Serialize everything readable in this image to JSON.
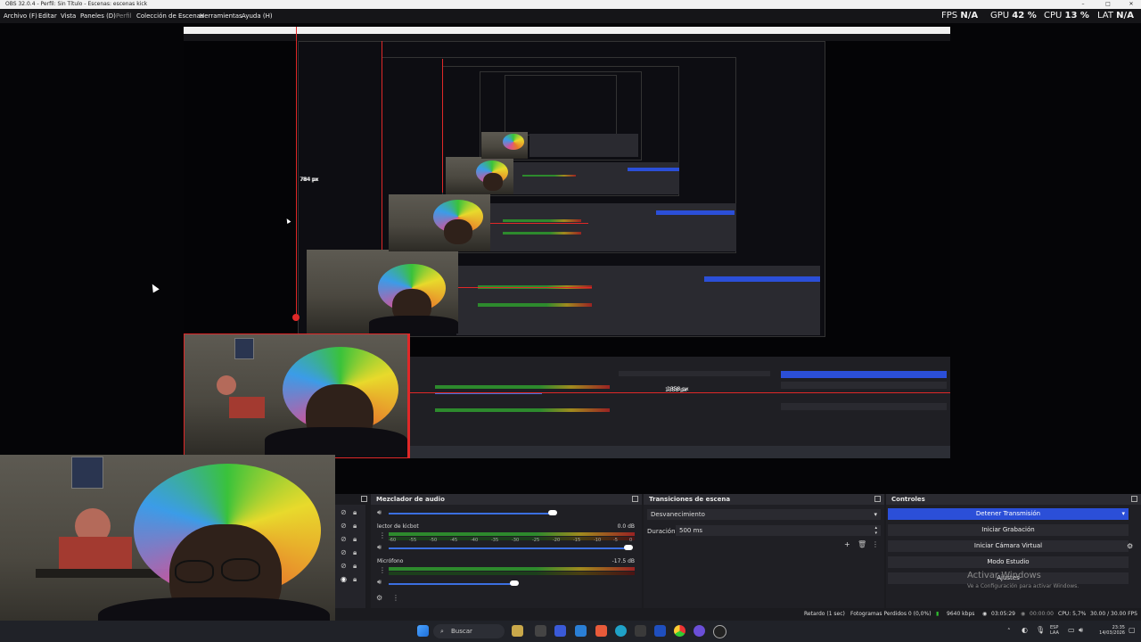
{
  "window": {
    "title": "OBS 32.0.4 - Perfil: Sin Título - Escenas: escenas kick"
  },
  "menu": {
    "items": [
      "Archivo (F)",
      "Editar",
      "Vista",
      "Paneles (D)",
      "Perfil",
      "Colección de Escenas",
      "Herramientas",
      "Ayuda (H)"
    ]
  },
  "stats": {
    "fps_label": "FPS",
    "fps_value": "N/A",
    "gpu_label": "GPU",
    "gpu_value": "42 %",
    "cpu_label": "CPU",
    "cpu_value": "13 %",
    "lat_label": "LAT",
    "lat_value": "N/A"
  },
  "preview": {
    "px_label_1": "784 px",
    "px_label_2": "1358 px",
    "px_label_3": "784 px"
  },
  "mixer": {
    "title": "Mezclador de audio",
    "tracks": [
      {
        "name": "",
        "db": ""
      },
      {
        "name": "lector de kicbot",
        "db": "0.0 dB"
      },
      {
        "name": "Micrófono",
        "db": "-17.5 dB"
      }
    ],
    "ticks": [
      "-60",
      "-55",
      "-50",
      "-45",
      "-40",
      "-35",
      "-30",
      "-25",
      "-20",
      "-15",
      "-10",
      "-5",
      "0"
    ]
  },
  "transitions": {
    "title": "Transiciones de escena",
    "selected": "Desvanecimiento",
    "duration_label": "Duración",
    "duration_value": "500 ms"
  },
  "controls": {
    "title": "Controles",
    "buttons": [
      "Detener Transmisión",
      "Iniciar Grabación",
      "Iniciar Cámara Virtual",
      "Modo Estudio",
      "Ajustes"
    ]
  },
  "activation": {
    "title": "Activar Windows",
    "subtitle": "Ve a Configuración para activar Windows."
  },
  "statusbar": {
    "delay": "Retardo (1 sec)",
    "dropped": "Fotogramas Perdidos 0 (0,0%)",
    "bitrate": "9640 kbps",
    "stream_time": "03:05:29",
    "rec_time": "00:00:00",
    "cpu": "CPU: 5,7%",
    "fps": "30.00 / 30.00 FPS"
  },
  "taskbar": {
    "search_placeholder": "Buscar",
    "lang_top": "ESP",
    "lang_bottom": "LAA",
    "time": "23:35",
    "date": "14/03/2026"
  },
  "colors": {
    "accent": "#2b4fd8",
    "guide_red": "#e02828"
  }
}
